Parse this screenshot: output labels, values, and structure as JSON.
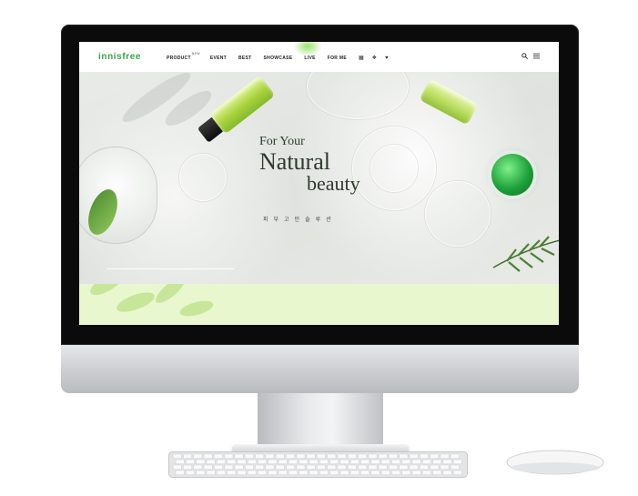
{
  "site": {
    "logo": "innisfree",
    "nav": [
      {
        "label": "PRODUCT",
        "badge": "NEW"
      },
      {
        "label": "EVENT"
      },
      {
        "label": "BEST"
      },
      {
        "label": "SHOWCASE"
      },
      {
        "label": "LIVE"
      },
      {
        "label": "FOR ME"
      }
    ],
    "nav_icons": [
      "cart-icon",
      "gift-icon",
      "coupon-icon"
    ],
    "header_actions": [
      "search-icon",
      "menu-icon"
    ]
  },
  "hero": {
    "line1": "For Your",
    "line2": "Natural",
    "line3": "beauty",
    "subtitle": "피부고민솔루션"
  },
  "colors": {
    "brand_green": "#3aa548",
    "band": "#e9f7cf",
    "bezel": "#0b0b0b"
  }
}
